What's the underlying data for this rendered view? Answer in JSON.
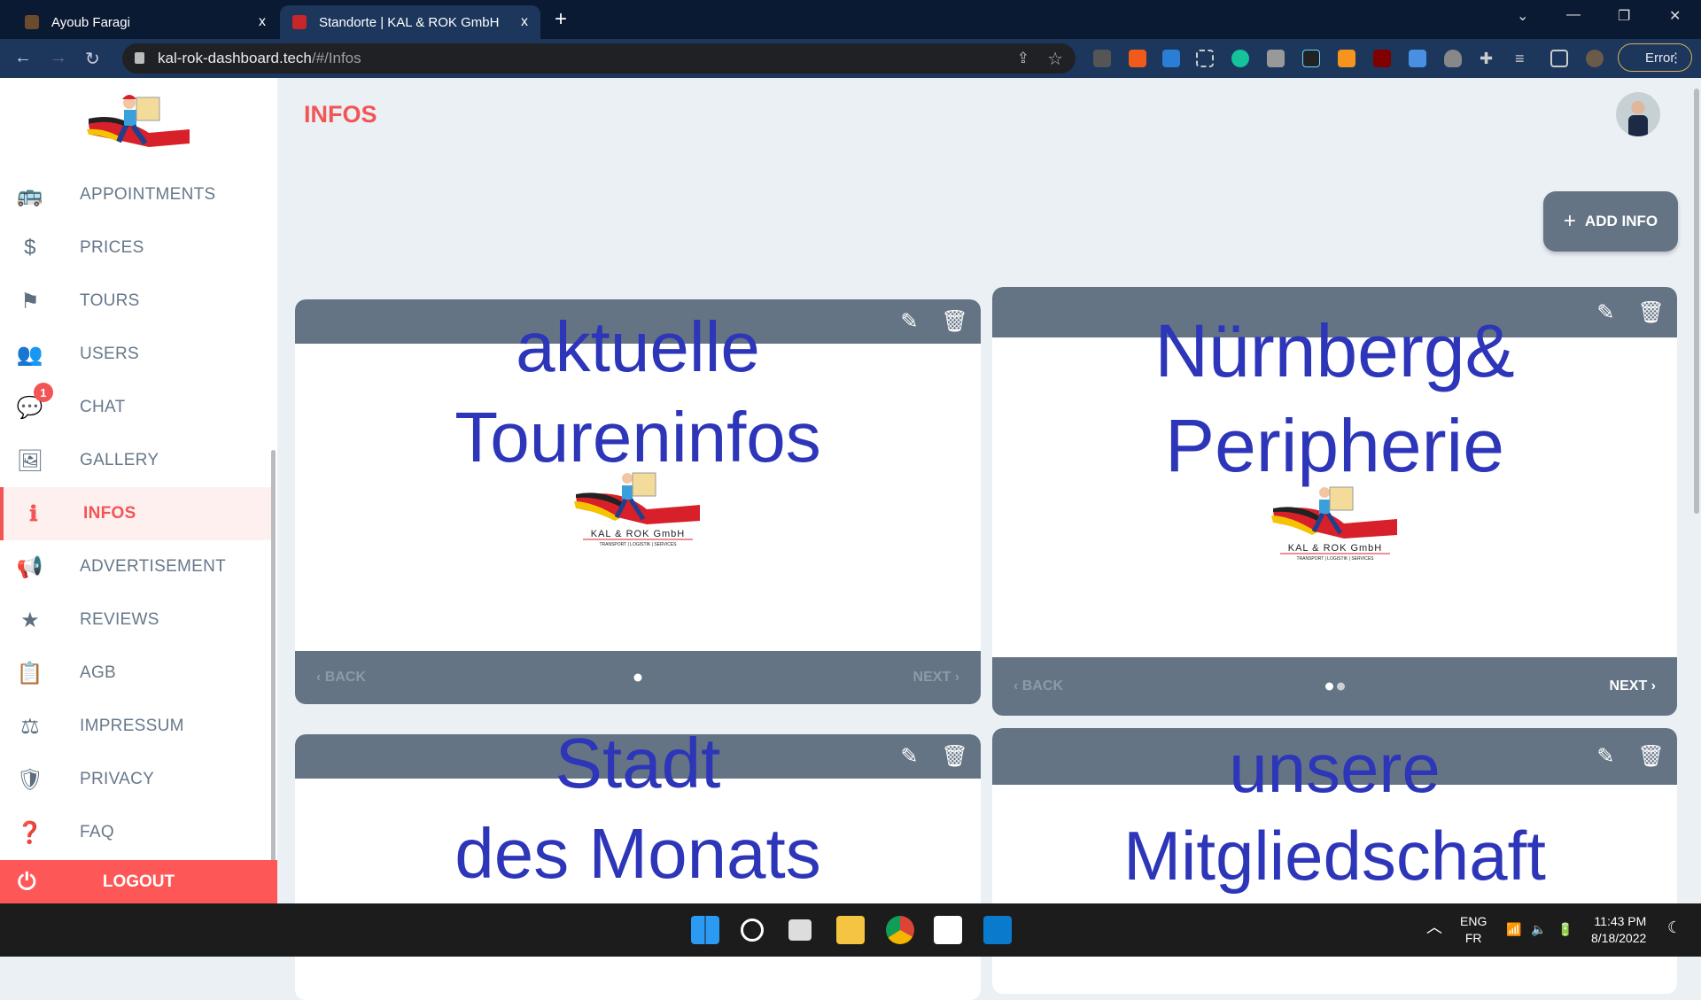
{
  "browser": {
    "tabs": [
      {
        "title": "Ayoub Faragi",
        "active": false
      },
      {
        "title": "Standorte | KAL & ROK GmbH",
        "active": true
      }
    ],
    "close_glyph": "x",
    "new_tab_glyph": "+",
    "url_host": "kal-rok-dashboard.tech",
    "url_path": "/#/Infos",
    "error_label": "Error"
  },
  "sidebar": {
    "items": [
      {
        "label": "APPOINTMENTS",
        "icon": "bus-clock-icon",
        "glyph": "🚌"
      },
      {
        "label": "PRICES",
        "icon": "dollar-icon",
        "glyph": "$"
      },
      {
        "label": "TOURS",
        "icon": "flag-icon",
        "glyph": "⚑"
      },
      {
        "label": "USERS",
        "icon": "users-icon",
        "glyph": "👥"
      },
      {
        "label": "CHAT",
        "icon": "chat-icon",
        "glyph": "💬",
        "badge": "1"
      },
      {
        "label": "GALLERY",
        "icon": "gallery-icon",
        "glyph": "🖼"
      },
      {
        "label": "INFOS",
        "icon": "info-icon",
        "glyph": "ℹ",
        "active": true
      },
      {
        "label": "ADVERTISEMENT",
        "icon": "megaphone-icon",
        "glyph": "📢"
      },
      {
        "label": "REVIEWS",
        "icon": "star-icon",
        "glyph": "★"
      },
      {
        "label": "AGB",
        "icon": "clipboard-icon",
        "glyph": "📋"
      },
      {
        "label": "IMPRESSUM",
        "icon": "gavel-icon",
        "glyph": "⚖"
      },
      {
        "label": "PRIVACY",
        "icon": "shield-user-icon",
        "glyph": "🛡"
      },
      {
        "label": "FAQ",
        "icon": "question-library-icon",
        "glyph": "❓"
      }
    ],
    "logout_label": "LOGOUT"
  },
  "page": {
    "title": "INFOS",
    "add_button": "ADD INFO"
  },
  "cards": [
    {
      "lines": [
        "aktuelle",
        "Toureninfos"
      ],
      "logo_text": "KAL & ROK GmbH",
      "logo_sub": "TRANSPORT | LOGISTIK | SERVICES",
      "back": "BACK",
      "next": "NEXT",
      "slides": 1,
      "current": 1
    },
    {
      "lines": [
        "Nürnberg&",
        "Peripherie"
      ],
      "logo_text": "KAL & ROK GmbH",
      "logo_sub": "TRANSPORT | LOGISTIK | SERVICES",
      "back": "BACK",
      "next": "NEXT",
      "slides": 2,
      "current": 1
    },
    {
      "lines": [
        "Stadt",
        "des Monats"
      ]
    },
    {
      "lines": [
        "unsere",
        "Mitgliedschaft"
      ]
    }
  ],
  "taskbar": {
    "lang1": "ENG",
    "lang2": "FR",
    "time": "11:43 PM",
    "date": "8/18/2022"
  },
  "colors": {
    "accent": "#f25555",
    "slate": "#647484",
    "card_text": "#2d35b9",
    "background": "#ebf0f5"
  }
}
